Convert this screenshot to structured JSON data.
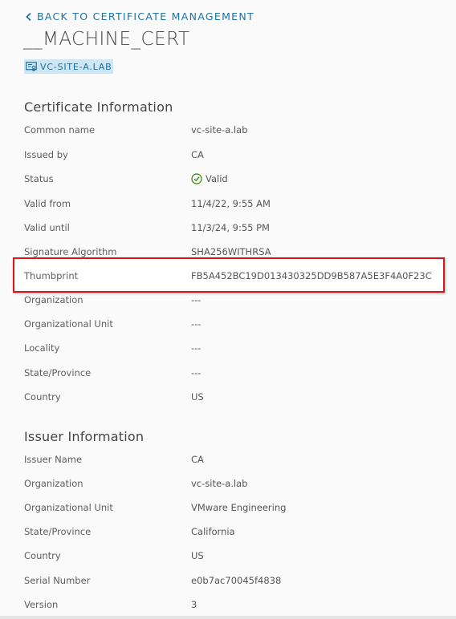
{
  "back_link": {
    "label": "BACK TO CERTIFICATE MANAGEMENT"
  },
  "title": "__MACHINE_CERT",
  "host_tag": "VC-SITE-A.LAB",
  "certificate_info": {
    "heading": "Certificate Information",
    "rows": [
      {
        "label": "Common name",
        "value": "vc-site-a.lab"
      },
      {
        "label": "Issued by",
        "value": "CA"
      },
      {
        "label": "Status",
        "value": "Valid"
      },
      {
        "label": "Valid from",
        "value": "11/4/22, 9:55 AM"
      },
      {
        "label": "Valid until",
        "value": "11/3/24, 9:55 PM"
      },
      {
        "label": "Signature Algorithm",
        "value": "SHA256WITHRSA"
      },
      {
        "label": "Thumbprint",
        "value": "FB5A452BC19D013430325DD9B587A5E3F4A0F23C"
      },
      {
        "label": "Organization",
        "value": "---"
      },
      {
        "label": "Organizational Unit",
        "value": "---"
      },
      {
        "label": "Locality",
        "value": "---"
      },
      {
        "label": "State/Province",
        "value": "---"
      },
      {
        "label": "Country",
        "value": "US"
      }
    ]
  },
  "issuer_info": {
    "heading": "Issuer Information",
    "rows": [
      {
        "label": "Issuer Name",
        "value": "CA"
      },
      {
        "label": "Organization",
        "value": "vc-site-a.lab"
      },
      {
        "label": "Organizational Unit",
        "value": "VMware Engineering"
      },
      {
        "label": "State/Province",
        "value": "California"
      },
      {
        "label": "Country",
        "value": "US"
      },
      {
        "label": "Serial Number",
        "value": "e0b7ac70045f4838"
      },
      {
        "label": "Version",
        "value": "3"
      }
    ]
  },
  "colors": {
    "link": "#1a73a8",
    "tag_bg": "#cde6f3",
    "highlight": "#d9141b",
    "valid": "#2f8400"
  },
  "icons": {
    "back": "chevron-left-icon",
    "tag": "certificate-icon",
    "status": "check-circle-icon"
  }
}
